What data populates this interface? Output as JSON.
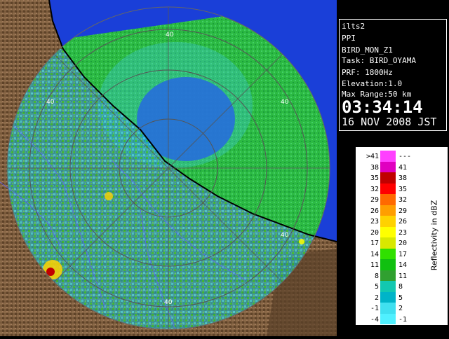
{
  "app": {
    "site": "ilts2",
    "scan_type": "PPI",
    "product": "BIRD_MON_Z1",
    "task": "Task: BIRD_OYAMA",
    "prf": "PRF: 1800Hz",
    "elevation": "Elevation:1.0",
    "max_range": "Max Range:50 km",
    "time": "03:34:14",
    "date": "16 NOV 2008 JST"
  },
  "map": {
    "range_ring_labels": [
      "40",
      "40",
      "40",
      "40",
      "40"
    ],
    "colors": {
      "sea": "#1a3fd8",
      "land": "#7a5a3c",
      "land_dark": "#4a3420",
      "land_light": "#a07a5a",
      "echo_cyan": "#22d8e0",
      "echo_green": "#2ed032",
      "echo_lightgreen": "#5be06a"
    }
  },
  "legend": {
    "title": "Reflectivity in dBZ",
    "left_labels": [
      ">41",
      "38",
      "35",
      "32",
      "29",
      "26",
      "23",
      "20",
      "17",
      "14",
      "11",
      "8",
      "5",
      "2",
      "-1",
      "-4"
    ],
    "right_labels": [
      "---",
      "41",
      "38",
      "35",
      "32",
      "29",
      "26",
      "23",
      "20",
      "17",
      "14",
      "11",
      "8",
      "5",
      "2",
      "-1"
    ],
    "colors": [
      "#ff40ff",
      "#e000c0",
      "#c00000",
      "#ff0000",
      "#ff6a00",
      "#ff9e00",
      "#ffd200",
      "#ffff00",
      "#d8e800",
      "#30e000",
      "#10c010",
      "#30a030",
      "#12c8b0",
      "#00b4c8",
      "#40e0f0",
      "#50f0ff"
    ]
  }
}
